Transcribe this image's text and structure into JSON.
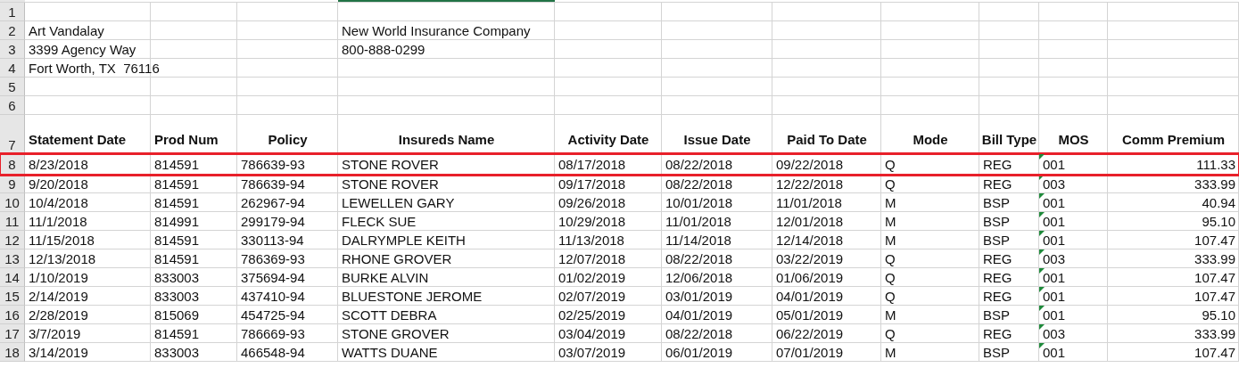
{
  "sheet": {
    "rows": [
      {
        "number": "1",
        "kind": "blank"
      },
      {
        "number": "2",
        "kind": "info",
        "cells": {
          "a": "Art Vandalay",
          "d": "New World Insurance Company"
        }
      },
      {
        "number": "3",
        "kind": "info",
        "cells": {
          "a": "3399 Agency Way",
          "d": "800-888-0299"
        }
      },
      {
        "number": "4",
        "kind": "info",
        "cells": {
          "a": "Fort Worth, TX  76116"
        }
      },
      {
        "number": "5",
        "kind": "blank"
      },
      {
        "number": "6",
        "kind": "blank"
      },
      {
        "number": "7",
        "kind": "header",
        "cells": {
          "a": "Statement Date",
          "b": "Prod Num",
          "c": "Policy",
          "d": "Insureds Name",
          "e": "Activity Date",
          "f": "Issue Date",
          "g": "Paid To Date",
          "h": "Mode",
          "i": "Bill Type",
          "j": "MOS",
          "k": "Comm Premium"
        }
      },
      {
        "number": "8",
        "kind": "data",
        "highlighted": true,
        "mos_flag": true,
        "cells": {
          "a": "8/23/2018",
          "b": "814591",
          "c": "786639-93",
          "d": "STONE ROVER",
          "e": "08/17/2018",
          "f": "08/22/2018",
          "g": "09/22/2018",
          "h": "Q",
          "i": "REG",
          "j": "001",
          "k": "111.33"
        }
      },
      {
        "number": "9",
        "kind": "data",
        "highlighted": false,
        "mos_flag": true,
        "cells": {
          "a": "9/20/2018",
          "b": "814591",
          "c": "786639-94",
          "d": "STONE ROVER",
          "e": "09/17/2018",
          "f": "08/22/2018",
          "g": "12/22/2018",
          "h": "Q",
          "i": "REG",
          "j": "003",
          "k": "333.99"
        }
      },
      {
        "number": "10",
        "kind": "data",
        "highlighted": false,
        "mos_flag": true,
        "cells": {
          "a": "10/4/2018",
          "b": "814591",
          "c": "262967-94",
          "d": "LEWELLEN GARY",
          "e": "09/26/2018",
          "f": "10/01/2018",
          "g": "11/01/2018",
          "h": "M",
          "i": "BSP",
          "j": "001",
          "k": "40.94"
        }
      },
      {
        "number": "11",
        "kind": "data",
        "highlighted": false,
        "mos_flag": true,
        "cells": {
          "a": "11/1/2018",
          "b": "814991",
          "c": "299179-94",
          "d": "FLECK SUE",
          "e": "10/29/2018",
          "f": "11/01/2018",
          "g": "12/01/2018",
          "h": "M",
          "i": "BSP",
          "j": "001",
          "k": "95.10"
        }
      },
      {
        "number": "12",
        "kind": "data",
        "highlighted": false,
        "mos_flag": true,
        "cells": {
          "a": "11/15/2018",
          "b": "814591",
          "c": "330113-94",
          "d": "DALRYMPLE KEITH",
          "e": "11/13/2018",
          "f": "11/14/2018",
          "g": "12/14/2018",
          "h": "M",
          "i": "BSP",
          "j": "001",
          "k": "107.47"
        }
      },
      {
        "number": "13",
        "kind": "data",
        "highlighted": false,
        "mos_flag": true,
        "cells": {
          "a": "12/13/2018",
          "b": "814591",
          "c": "786369-93",
          "d": "RHONE GROVER",
          "e": "12/07/2018",
          "f": "08/22/2018",
          "g": "03/22/2019",
          "h": "Q",
          "i": "REG",
          "j": "003",
          "k": "333.99"
        }
      },
      {
        "number": "14",
        "kind": "data",
        "highlighted": false,
        "mos_flag": true,
        "cells": {
          "a": "1/10/2019",
          "b": "833003",
          "c": "375694-94",
          "d": "BURKE ALVIN",
          "e": "01/02/2019",
          "f": "12/06/2018",
          "g": "01/06/2019",
          "h": "Q",
          "i": "REG",
          "j": "001",
          "k": "107.47"
        }
      },
      {
        "number": "15",
        "kind": "data",
        "highlighted": false,
        "mos_flag": true,
        "cells": {
          "a": "2/14/2019",
          "b": "833003",
          "c": "437410-94",
          "d": "BLUESTONE JEROME",
          "e": "02/07/2019",
          "f": "03/01/2019",
          "g": "04/01/2019",
          "h": "Q",
          "i": "REG",
          "j": "001",
          "k": "107.47"
        }
      },
      {
        "number": "16",
        "kind": "data",
        "highlighted": false,
        "mos_flag": true,
        "cells": {
          "a": "2/28/2019",
          "b": "815069",
          "c": "454725-94",
          "d": "SCOTT DEBRA",
          "e": "02/25/2019",
          "f": "04/01/2019",
          "g": "05/01/2019",
          "h": "M",
          "i": "BSP",
          "j": "001",
          "k": "95.10"
        }
      },
      {
        "number": "17",
        "kind": "data",
        "highlighted": false,
        "mos_flag": true,
        "cells": {
          "a": "3/7/2019",
          "b": "814591",
          "c": "786669-93",
          "d": "STONE GROVER",
          "e": "03/04/2019",
          "f": "08/22/2018",
          "g": "06/22/2019",
          "h": "Q",
          "i": "REG",
          "j": "003",
          "k": "333.99"
        }
      },
      {
        "number": "18",
        "kind": "data",
        "highlighted": false,
        "mos_flag": true,
        "cells": {
          "a": "3/14/2019",
          "b": "833003",
          "c": "466548-94",
          "d": "WATTS DUANE",
          "e": "03/07/2019",
          "f": "06/01/2019",
          "g": "07/01/2019",
          "h": "M",
          "i": "BSP",
          "j": "001",
          "k": "107.47"
        }
      }
    ]
  }
}
